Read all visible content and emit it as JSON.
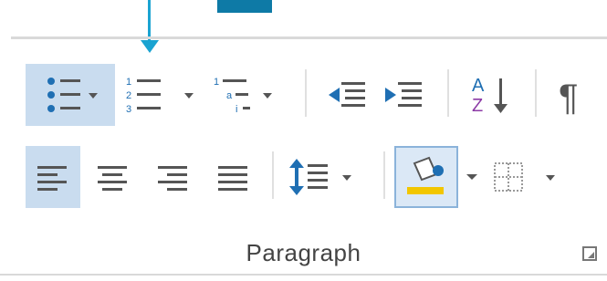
{
  "ribbon_group": {
    "name": "Paragraph"
  },
  "icons": {
    "bullets": "bullets-icon",
    "numbering": "numbering-icon",
    "multilevel": "multilevel-list-icon",
    "decrease_indent": "decrease-indent-icon",
    "increase_indent": "increase-indent-icon",
    "sort": "sort-icon",
    "show_marks": "paragraph-mark-icon",
    "align_left": "align-left-icon",
    "center": "align-center-icon",
    "align_right": "align-right-icon",
    "justify": "justify-icon",
    "line_spacing": "line-spacing-icon",
    "shading": "shading-icon",
    "borders": "borders-icon",
    "launcher": "dialog-launcher-icon"
  },
  "colors": {
    "active_bg": "#c9dcef",
    "callout": "#1aa3d1",
    "icon_blue": "#1f6fb3",
    "icon_gray": "#555555"
  },
  "state": {
    "bullets_active": true,
    "align_left_active": true,
    "shading_selected": true
  }
}
